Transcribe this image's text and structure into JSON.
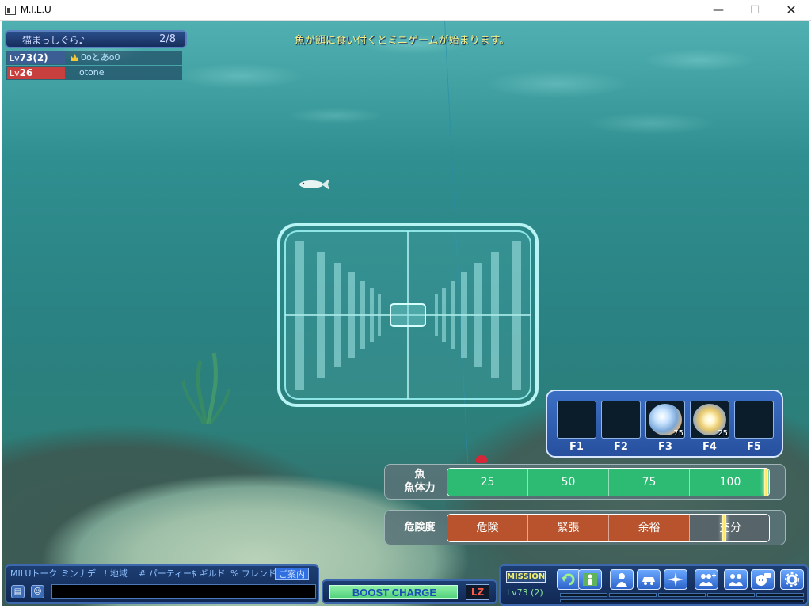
{
  "window": {
    "title": "M.I.L.U"
  },
  "message": "魚が餌に食い付くとミニゲームが始まります。",
  "party": {
    "name": "猫まっしぐら♪",
    "count": "2/8",
    "members": [
      {
        "lv_prefix": "Lv",
        "lv": "73(2)",
        "name": "0oとあo0",
        "leader": true,
        "lv_color": "#3b5f94"
      },
      {
        "lv_prefix": "Lv",
        "lv": "26",
        "name": "otone",
        "leader": false,
        "lv_color": "#c8403e"
      }
    ]
  },
  "skills": [
    {
      "key": "F1",
      "item": null,
      "count": ""
    },
    {
      "key": "F2",
      "item": null,
      "count": ""
    },
    {
      "key": "F3",
      "item": "bubble-orb-icon",
      "count": "75"
    },
    {
      "key": "F4",
      "item": "sparkle-orb-icon",
      "count": "25"
    },
    {
      "key": "F5",
      "item": null,
      "count": ""
    }
  ],
  "stamina": {
    "label_line1": "魚",
    "label_line2": "魚体力",
    "segments": [
      "25",
      "50",
      "75",
      "100"
    ],
    "value": 1.0,
    "color": "#2dba73"
  },
  "danger": {
    "label": "危険度",
    "segments": [
      "危険",
      "緊張",
      "余裕",
      "充分"
    ],
    "value": 0.85,
    "color": "#b9532d"
  },
  "chat": {
    "tabs": [
      "MILUトーク",
      "ミンナデ",
      "! 地域",
      "# パーティー",
      "$ ギルド",
      "% フレンド",
      "ご案内"
    ],
    "active_tab": "ご案内",
    "input_value": ""
  },
  "boost": {
    "label": "BOOST CHARGE",
    "lz_label": "LZ"
  },
  "menu": {
    "mission_label": "MISSION",
    "level_text": "Lv73 (2)",
    "icons": [
      "refresh-icon",
      "character-icon",
      "profile-icon",
      "vehicle-icon",
      "sparkle-icon",
      "add-friend-icon",
      "party-icon",
      "chat-bubble-icon",
      "settings-icon"
    ]
  }
}
